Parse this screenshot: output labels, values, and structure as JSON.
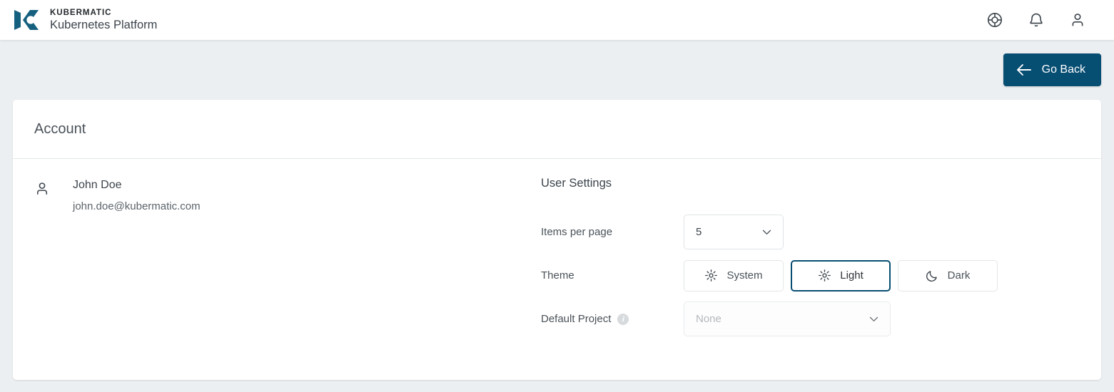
{
  "brand": {
    "line1": "KUBERMATIC",
    "line2": "Kubernetes Platform",
    "logo_icon": "kubermatic-logo-icon",
    "logo_color": "#16607f"
  },
  "topbar": {
    "icons": [
      {
        "name": "help-icon",
        "label": "Help"
      },
      {
        "name": "notifications-bell-icon",
        "label": "Notifications"
      },
      {
        "name": "user-account-icon",
        "label": "Account"
      }
    ]
  },
  "toolbar": {
    "go_back_label": "Go Back",
    "go_back_icon": "arrow-left-icon",
    "go_back_color": "#074e73"
  },
  "card": {
    "title": "Account"
  },
  "user": {
    "icon": "person-icon",
    "name": "John Doe",
    "email": "john.doe@kubermatic.com"
  },
  "settings": {
    "title": "User Settings",
    "items_per_page": {
      "label": "Items per page",
      "value": "5",
      "chevron_icon": "chevron-down-icon"
    },
    "theme": {
      "label": "Theme",
      "options": [
        {
          "label": "System",
          "icon": "sun-icon",
          "selected": false
        },
        {
          "label": "Light",
          "icon": "sun-icon",
          "selected": true
        },
        {
          "label": "Dark",
          "icon": "moon-icon",
          "selected": false
        }
      ],
      "selected": "Light",
      "selected_color": "#074e73"
    },
    "default_project": {
      "label": "Default Project",
      "info_icon": "info-icon",
      "info_glyph": "i",
      "placeholder": "None",
      "value": "",
      "chevron_icon": "chevron-down-icon"
    }
  }
}
